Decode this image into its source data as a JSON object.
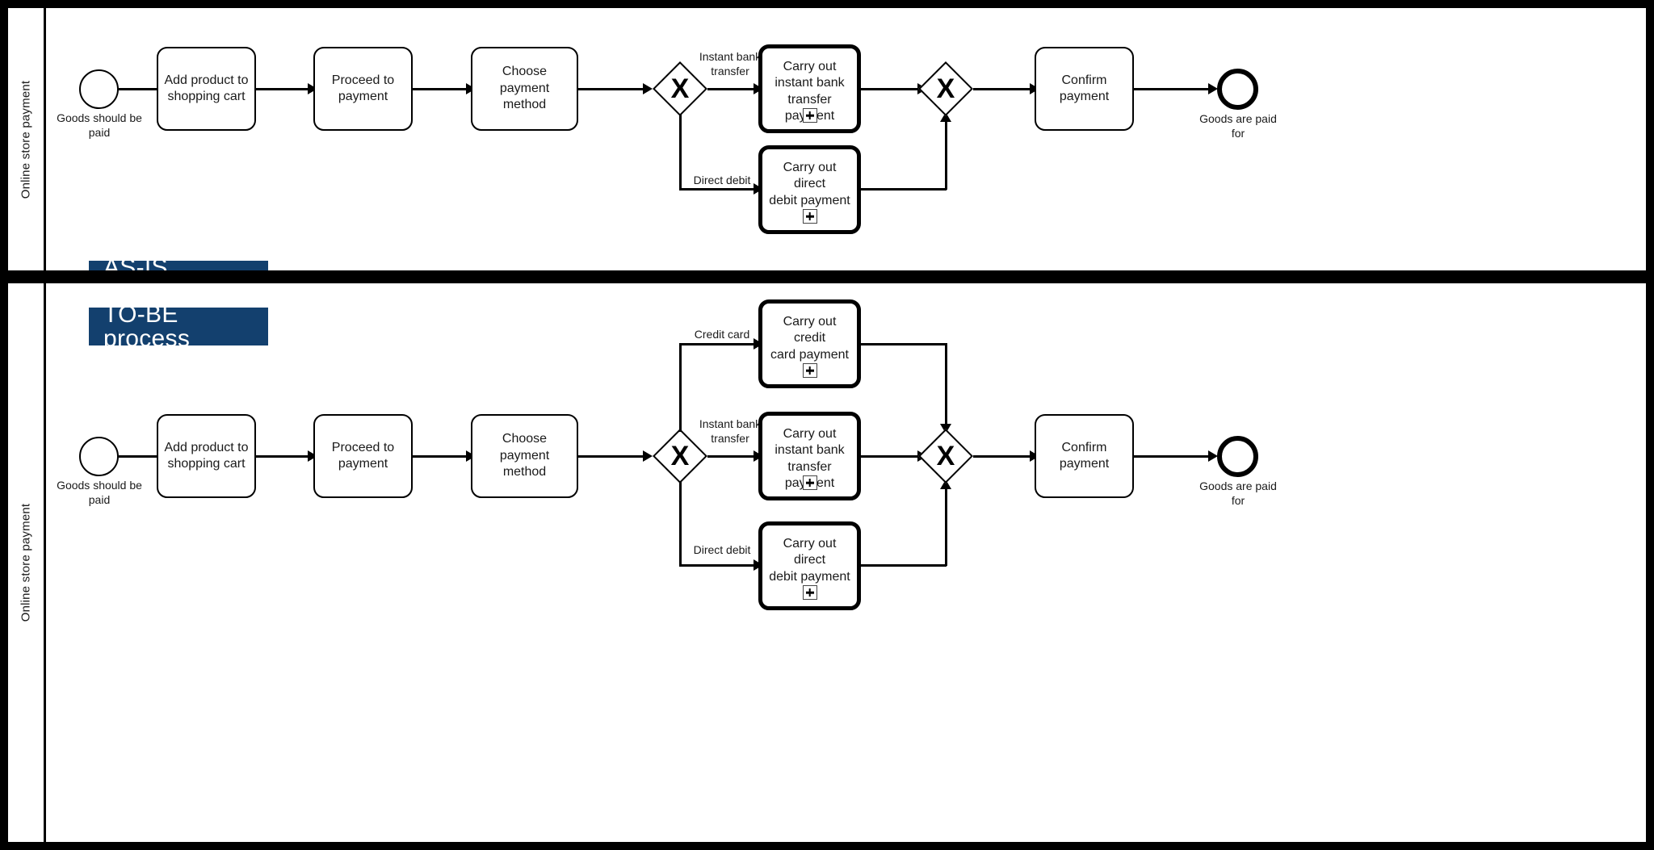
{
  "diagram": {
    "type": "bpmn",
    "title": "Online store payment process comparison",
    "background_color": "#000000",
    "accent_color": "#13406e"
  },
  "lanes": [
    {
      "id": "as-is",
      "header_label": "Online store payment",
      "badge": "AS-IS process",
      "nodes": {
        "start_event": {
          "label": "Goods should be\npaid",
          "kind": "start-event"
        },
        "task_add": {
          "label": "Add product to\nshopping cart",
          "kind": "task"
        },
        "task_proceed": {
          "label": "Proceed to\npayment",
          "kind": "task"
        },
        "task_choose": {
          "label": "Choose\npayment method",
          "kind": "task"
        },
        "gateway_split": {
          "marker": "X",
          "kind": "exclusive-gateway"
        },
        "sub_instant": {
          "label": "Carry out\ninstant bank\ntransfer payment",
          "kind": "subprocess"
        },
        "sub_direct": {
          "label": "Carry out direct\ndebit payment",
          "kind": "subprocess"
        },
        "gateway_merge": {
          "marker": "X",
          "kind": "exclusive-gateway"
        },
        "task_confirm": {
          "label": "Confirm\npayment",
          "kind": "task"
        },
        "end_event": {
          "label": "Goods are paid\nfor",
          "kind": "end-event"
        }
      },
      "flow_labels": {
        "instant": "Instant bank\ntransfer",
        "direct": "Direct debit"
      }
    },
    {
      "id": "to-be",
      "header_label": "Online store payment",
      "badge": "TO-BE process",
      "nodes": {
        "start_event": {
          "label": "Goods should be\npaid",
          "kind": "start-event"
        },
        "task_add": {
          "label": "Add product to\nshopping cart",
          "kind": "task"
        },
        "task_proceed": {
          "label": "Proceed to\npayment",
          "kind": "task"
        },
        "task_choose": {
          "label": "Choose\npayment method",
          "kind": "task"
        },
        "gateway_split": {
          "marker": "X",
          "kind": "exclusive-gateway"
        },
        "sub_credit": {
          "label": "Carry out credit\ncard payment",
          "kind": "subprocess"
        },
        "sub_instant": {
          "label": "Carry out\ninstant bank\ntransfer payment",
          "kind": "subprocess"
        },
        "sub_direct": {
          "label": "Carry out direct\ndebit payment",
          "kind": "subprocess"
        },
        "gateway_merge": {
          "marker": "X",
          "kind": "exclusive-gateway"
        },
        "task_confirm": {
          "label": "Confirm\npayment",
          "kind": "task"
        },
        "end_event": {
          "label": "Goods are paid\nfor",
          "kind": "end-event"
        }
      },
      "flow_labels": {
        "credit": "Credit card",
        "instant": "Instant bank\ntransfer",
        "direct": "Direct debit"
      }
    }
  ]
}
